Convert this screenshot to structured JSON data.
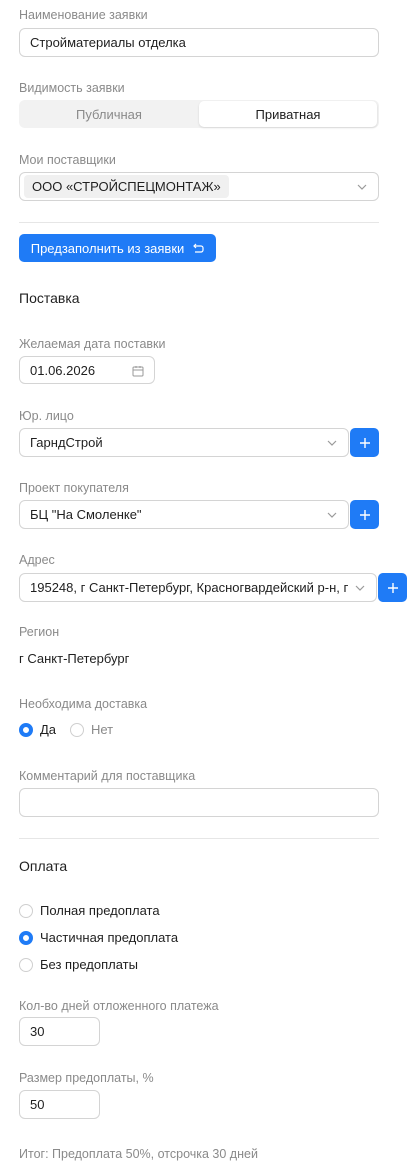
{
  "request_name": {
    "label": "Наименование заявки",
    "value": "Стройматериалы отделка"
  },
  "visibility": {
    "label": "Видимость заявки",
    "options": [
      "Публичная",
      "Приватная"
    ],
    "selected": "Приватная"
  },
  "suppliers": {
    "label": "Мои поставщики",
    "tag": "ООО «СТРОЙСПЕЦМОНТАЖ»"
  },
  "prefill_button": {
    "label": "Предзаполнить из заявки"
  },
  "delivery": {
    "title": "Поставка",
    "date": {
      "label": "Желаемая дата поставки",
      "value": "01.06.2026"
    },
    "legal_entity": {
      "label": "Юр. лицо",
      "value": "ГарндСтрой"
    },
    "project": {
      "label": "Проект покупателя",
      "value": "БЦ \"На Смоленке\""
    },
    "address": {
      "label": "Адрес",
      "value": "195248, г Санкт-Петербург, Красногвардейский р-н, п..."
    },
    "region": {
      "label": "Регион",
      "value": "г Санкт-Петербург"
    },
    "need_delivery": {
      "label": "Необходима доставка",
      "options": [
        "Да",
        "Нет"
      ],
      "selected": "Да"
    },
    "comment": {
      "label": "Комментарий для поставщика",
      "value": ""
    }
  },
  "payment": {
    "title": "Оплата",
    "options": [
      "Полная предоплата",
      "Частичная предоплата",
      "Без предоплаты"
    ],
    "selected": "Частичная предоплата",
    "deferred_days": {
      "label": "Кол-во дней отложенного платежа",
      "value": "30"
    },
    "prepayment_percent": {
      "label": "Размер предоплаты, %",
      "value": "50"
    },
    "summary": "Итог: Предоплата 50%, отсрочка 30 дней"
  },
  "colors": {
    "accent": "#1f7bf6",
    "border": "#d4d4d4",
    "label": "#8a8a8a"
  }
}
